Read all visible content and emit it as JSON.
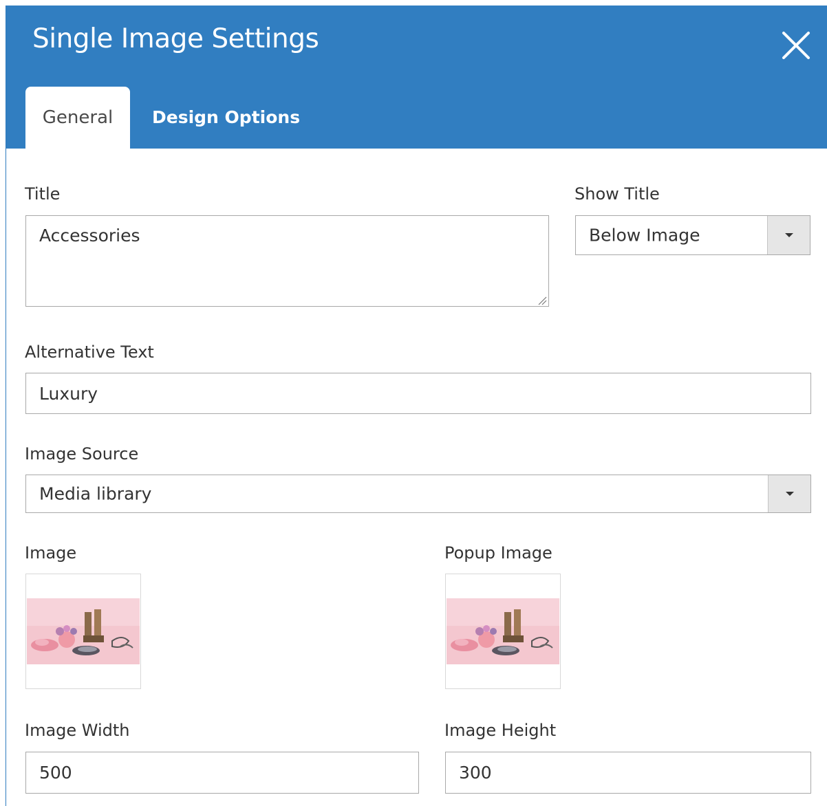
{
  "dialog": {
    "title": "Single Image Settings",
    "close_icon": "close-icon"
  },
  "tabs": [
    {
      "label": "General",
      "active": true
    },
    {
      "label": "Design Options",
      "active": false
    }
  ],
  "form": {
    "title": {
      "label": "Title",
      "value": "Accessories"
    },
    "show_title": {
      "label": "Show Title",
      "value": "Below Image"
    },
    "alt_text": {
      "label": "Alternative Text",
      "value": "Luxury"
    },
    "image_source": {
      "label": "Image Source",
      "value": "Media library"
    },
    "image": {
      "label": "Image"
    },
    "popup_image": {
      "label": "Popup Image"
    },
    "image_width": {
      "label": "Image Width",
      "value": "500"
    },
    "image_height": {
      "label": "Image Height",
      "value": "300"
    }
  },
  "colors": {
    "header": "#317ec1",
    "header_text": "#ffffff",
    "field_border": "#a8a8a8"
  }
}
